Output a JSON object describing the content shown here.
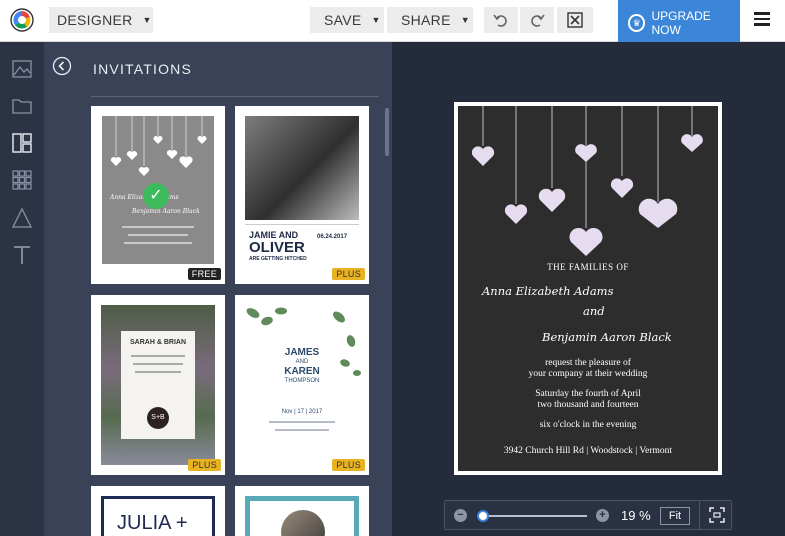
{
  "topbar": {
    "mode_label": "DESIGNER",
    "save_label": "SAVE",
    "share_label": "SHARE",
    "upgrade_label": "UPGRADE NOW",
    "icons": [
      "undo-icon",
      "redo-icon",
      "close-box-icon",
      "hamburger-menu-icon"
    ]
  },
  "left_rail": {
    "items": [
      "background-icon",
      "folder-icon",
      "layout-icon",
      "grid-icon",
      "shapes-icon",
      "text-icon"
    ]
  },
  "panel": {
    "title": "INVITATIONS",
    "templates": [
      {
        "badge": "FREE",
        "name_line1": "Anna Elizabeth Adams",
        "name_line2": "Benjamin Aaron Black"
      },
      {
        "badge": "PLUS",
        "name_line1": "JAMIE AND",
        "name_line2": "OLIVER",
        "subtitle": "ARE GETTING HITCHED",
        "date": "06.24.2017"
      },
      {
        "badge": "PLUS",
        "name_line1": "SARAH & BRIAN",
        "monogram": "S+B"
      },
      {
        "badge": "PLUS",
        "name_line1": "JAMES",
        "and": "AND",
        "name_line2": "KAREN",
        "surname": "THOMPSON",
        "date": "Nov | 17 | 2017"
      },
      {
        "name_line1": "JULIA +"
      },
      {}
    ]
  },
  "invitation": {
    "families": "THE FAMILIES OF",
    "name1": "Anna Elizabeth Adams",
    "and": "and",
    "name2": "Benjamin Aaron Black",
    "request1": "request the pleasure of",
    "request2": "your company at their wedding",
    "date1": "Saturday the fourth of April",
    "date2": "two thousand and fourteen",
    "time": "six o'clock in the evening",
    "address": "3942 Church Hill Rd | Woodstock | Vermont"
  },
  "zoom": {
    "percent": "19 %",
    "fit_label": "Fit",
    "level": 0.19
  },
  "colors": {
    "accent": "#3b86d8",
    "panel_bg": "#394256",
    "canvas_bg": "#242b3b",
    "plus_badge": "#e9b220"
  }
}
